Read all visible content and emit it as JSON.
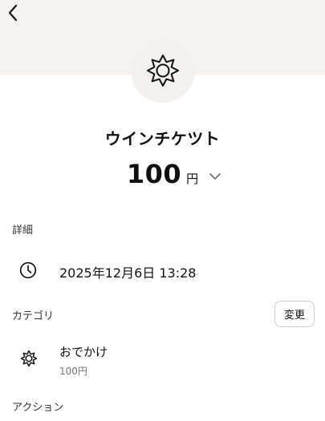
{
  "header": {
    "back_icon": "chevron-left-icon",
    "hero_icon": "sun-icon"
  },
  "item": {
    "title": "ウインチケツト",
    "amount": "100",
    "currency_unit": "円",
    "toggle_icon": "chevron-down-icon"
  },
  "details": {
    "label": "詳細",
    "date_icon": "clock-icon",
    "datetime": "2025年12月6日 13:28"
  },
  "category": {
    "label": "カテゴリ",
    "change_label": "変更",
    "icon": "sun-icon",
    "name": "おでかけ",
    "amount": "100円"
  },
  "actions": {
    "label": "アクション"
  }
}
